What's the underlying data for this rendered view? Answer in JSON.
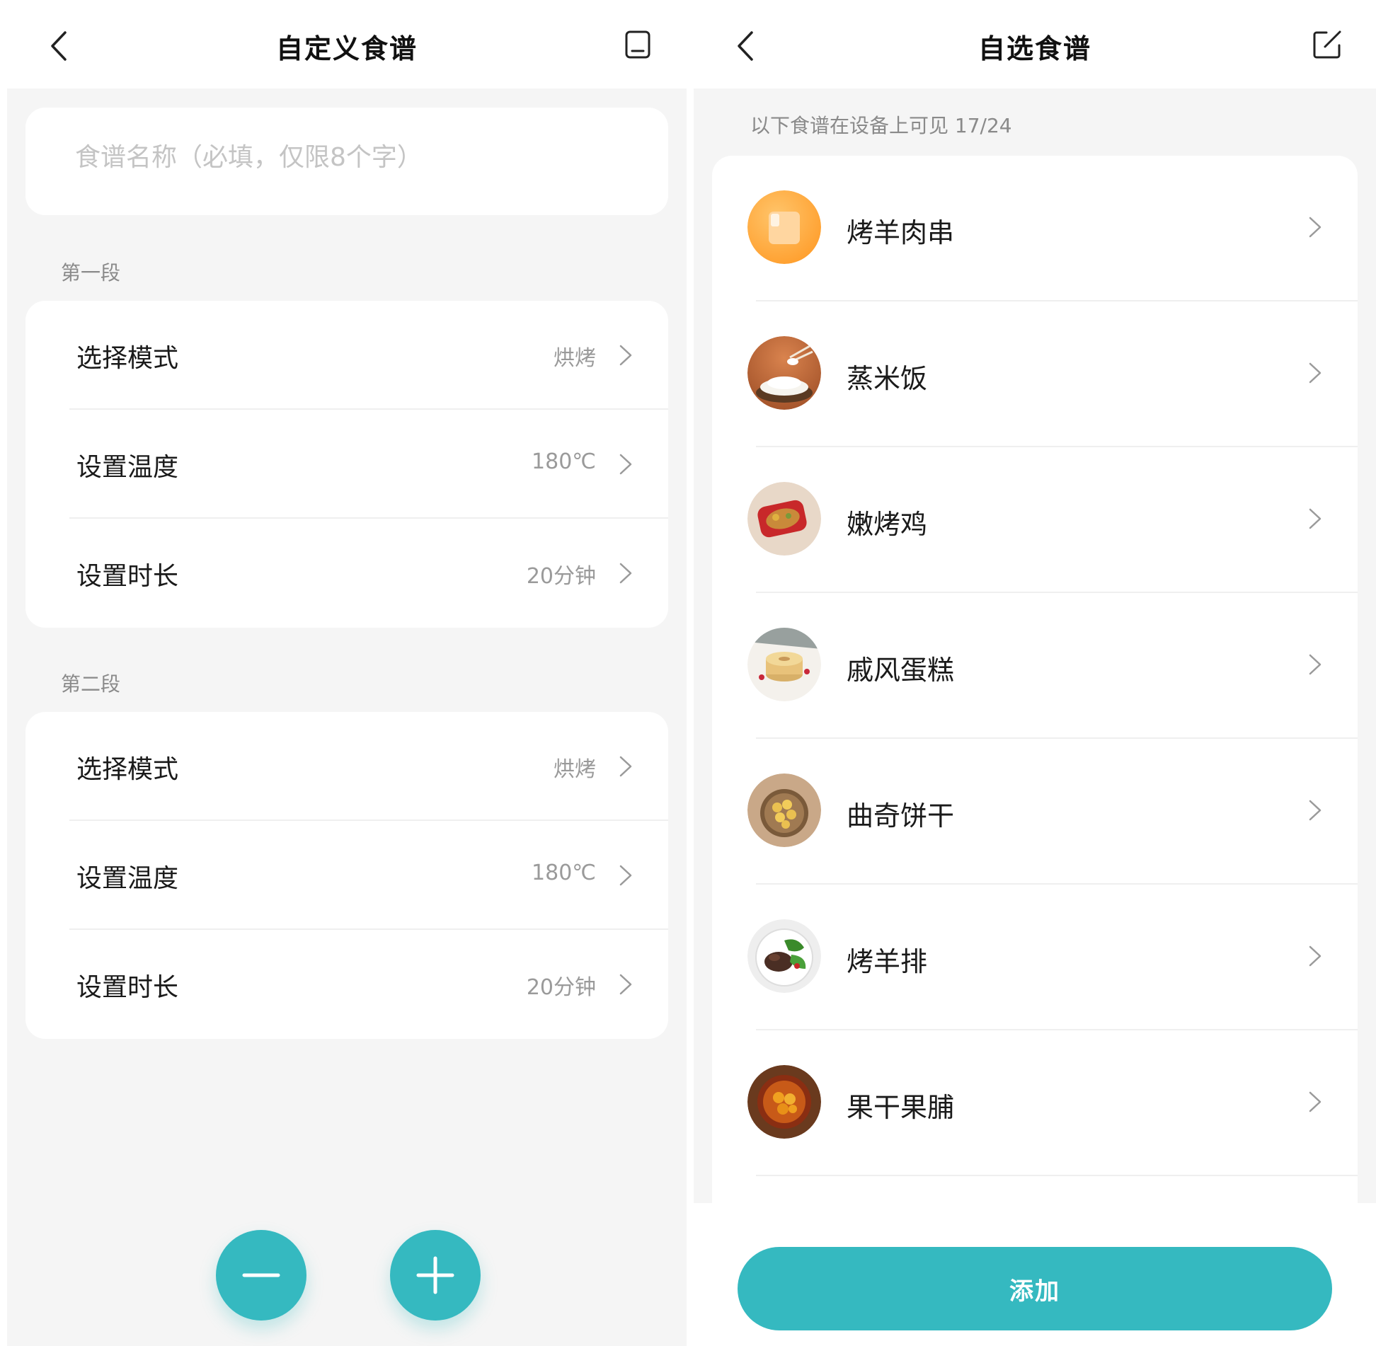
{
  "left_screen": {
    "title": "自定义食谱",
    "name_placeholder": "食谱名称（必填，仅限8个字）",
    "stages": [
      {
        "label": "第一段",
        "rows": [
          {
            "label": "选择模式",
            "value": "烘烤"
          },
          {
            "label": "设置温度",
            "value": "180℃"
          },
          {
            "label": "设置时长",
            "value": "20分钟"
          }
        ]
      },
      {
        "label": "第二段",
        "rows": [
          {
            "label": "选择模式",
            "value": "烘烤"
          },
          {
            "label": "设置温度",
            "value": "180℃"
          },
          {
            "label": "设置时长",
            "value": "20分钟"
          }
        ]
      }
    ],
    "icons": {
      "back": "back-arrow-icon",
      "save": "save-icon",
      "minus": "minus-icon",
      "plus": "plus-icon"
    }
  },
  "right_screen": {
    "title": "自选食谱",
    "hint": "以下食谱在设备上可见 17/24",
    "recipes": [
      {
        "label": "烤羊肉串",
        "thumb": "placeholder-orange-icon"
      },
      {
        "label": "蒸米饭",
        "thumb": "rice-photo"
      },
      {
        "label": "嫩烤鸡",
        "thumb": "roast-chicken-photo"
      },
      {
        "label": "戚风蛋糕",
        "thumb": "chiffon-cake-photo"
      },
      {
        "label": "曲奇饼干",
        "thumb": "cookies-photo"
      },
      {
        "label": "烤羊排",
        "thumb": "lamb-chops-photo"
      },
      {
        "label": "果干果脯",
        "thumb": "dried-fruit-photo"
      }
    ],
    "add_label": "添加",
    "icons": {
      "back": "back-arrow-icon",
      "edit": "edit-icon"
    }
  },
  "colors": {
    "accent": "#35b9c0",
    "background": "#f5f5f5",
    "card": "#ffffff",
    "secondary_text": "#8a8a8a"
  }
}
